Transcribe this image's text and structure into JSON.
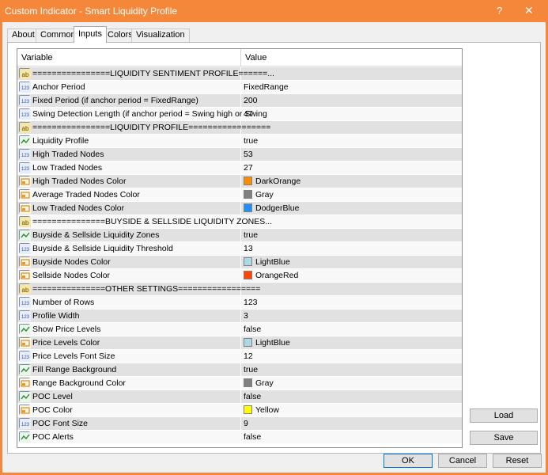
{
  "window": {
    "title": "Custom Indicator - Smart Liquidity Profile",
    "help_label": "?",
    "close_label": "✕",
    "frame_color": "#f4873a"
  },
  "tabs": [
    {
      "label": "About",
      "active": false
    },
    {
      "label": "Common",
      "active": false
    },
    {
      "label": "Inputs",
      "active": true
    },
    {
      "label": "Colors",
      "active": false
    },
    {
      "label": "Visualization",
      "active": false
    }
  ],
  "grid": {
    "headers": {
      "variable": "Variable",
      "value": "Value"
    },
    "rows": [
      {
        "icon": "ab-icon",
        "variable": "================LIQUIDITY SENTIMENT PROFILE======...",
        "value": "",
        "section": true
      },
      {
        "icon": "123-icon",
        "variable": "Anchor Period",
        "value": "FixedRange"
      },
      {
        "icon": "123-icon",
        "variable": "Fixed Period (if anchor period = FixedRange)",
        "value": "200"
      },
      {
        "icon": "123-icon",
        "variable": "Swing Detection Length (if anchor period = Swing high or Swing",
        "value": "47"
      },
      {
        "icon": "ab-icon",
        "variable": "================LIQUIDITY PROFILE=================",
        "value": "",
        "section": true
      },
      {
        "icon": "bool-icon",
        "variable": "Liquidity Profile",
        "value": "true"
      },
      {
        "icon": "123-icon",
        "variable": "High Traded Nodes",
        "value": "53"
      },
      {
        "icon": "123-icon",
        "variable": "Low Traded Nodes",
        "value": "27"
      },
      {
        "icon": "color-icon",
        "variable": "High Traded Nodes Color",
        "value": "DarkOrange",
        "swatch": "#ff8c00"
      },
      {
        "icon": "color-icon",
        "variable": "Average Traded Nodes Color",
        "value": "Gray",
        "swatch": "#808080"
      },
      {
        "icon": "color-icon",
        "variable": "Low Traded Nodes Color",
        "value": "DodgerBlue",
        "swatch": "#1e90ff"
      },
      {
        "icon": "ab-icon",
        "variable": "===============BUYSIDE & SELLSIDE LIQUIDITY ZONES...",
        "value": "",
        "section": true
      },
      {
        "icon": "bool-icon",
        "variable": "Buyside & Sellside Liquidity Zones",
        "value": "true"
      },
      {
        "icon": "123-icon",
        "variable": "Buyside & Sellside Liquidity Threshold",
        "value": "13"
      },
      {
        "icon": "color-icon",
        "variable": "Buyside Nodes Color",
        "value": "LightBlue",
        "swatch": "#add8e6"
      },
      {
        "icon": "color-icon",
        "variable": "Sellside Nodes Color",
        "value": "OrangeRed",
        "swatch": "#ff4500"
      },
      {
        "icon": "ab-icon",
        "variable": "===============OTHER SETTINGS=================",
        "value": "",
        "section": true
      },
      {
        "icon": "123-icon",
        "variable": "Number of Rows",
        "value": "123"
      },
      {
        "icon": "123-icon",
        "variable": "Profile Width",
        "value": "3"
      },
      {
        "icon": "bool-icon",
        "variable": "Show Price Levels",
        "value": "false"
      },
      {
        "icon": "color-icon",
        "variable": "Price Levels Color",
        "value": "LightBlue",
        "swatch": "#add8e6"
      },
      {
        "icon": "123-icon",
        "variable": "Price Levels Font Size",
        "value": "12"
      },
      {
        "icon": "bool-icon",
        "variable": "Fill Range Background",
        "value": "true"
      },
      {
        "icon": "color-icon",
        "variable": "Range Background Color",
        "value": "Gray",
        "swatch": "#808080"
      },
      {
        "icon": "bool-icon",
        "variable": "POC Level",
        "value": "false"
      },
      {
        "icon": "color-icon",
        "variable": "POC Color",
        "value": "Yellow",
        "swatch": "#ffff00"
      },
      {
        "icon": "123-icon",
        "variable": "POC Font Size",
        "value": "9"
      },
      {
        "icon": "bool-icon",
        "variable": "POC Alerts",
        "value": "false"
      }
    ]
  },
  "side_buttons": {
    "load": "Load",
    "save": "Save"
  },
  "footer_buttons": {
    "ok": "OK",
    "cancel": "Cancel",
    "reset": "Reset"
  }
}
